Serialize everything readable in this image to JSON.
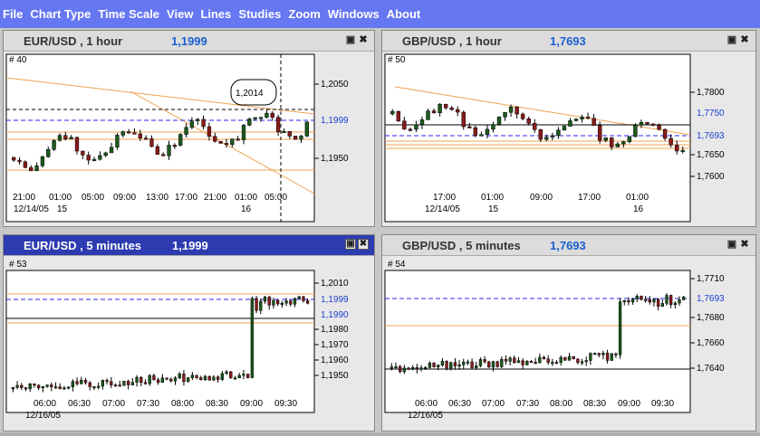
{
  "menu": [
    "File",
    "Chart Type",
    "Time Scale",
    "View",
    "Lines",
    "Studies",
    "Zoom",
    "Windows",
    "About"
  ],
  "colors": {
    "menubar": "#6677f2",
    "trendline": "#f0a050",
    "current": "#2a2af0",
    "up": "#1c5a1c",
    "down": "#8a1a1a"
  },
  "icons": {
    "minimize": "minimize-icon",
    "close": "close-icon"
  },
  "charts": [
    {
      "symbol": "EUR/USD , 1 hour",
      "price": "1,1999",
      "bar_id": "# 40",
      "active": false,
      "annotation": "1,2014",
      "y_ticks": [
        "1,2050",
        "1,1950"
      ],
      "current_label": "1,1999",
      "x_ticks": [
        "21:00",
        "01:00",
        "05:00",
        "09:00",
        "13:00",
        "17:00",
        "21:00",
        "01:00",
        "05:00"
      ],
      "date_labels": [
        "12/14/05",
        "15",
        "16"
      ]
    },
    {
      "symbol": "GBP/USD , 1 hour",
      "price": "1,7693",
      "bar_id": "# 50",
      "active": false,
      "y_ticks": [
        "1,7800",
        "1,7750",
        "1,7650",
        "1,7600"
      ],
      "current_label": "1,7693",
      "x_ticks": [
        "17:00",
        "01:00",
        "09:00",
        "17:00",
        "01:00"
      ],
      "date_labels": [
        "12/14/05",
        "15",
        "16"
      ]
    },
    {
      "symbol": "EUR/USD , 5 minutes",
      "price": "1,1999",
      "bar_id": "# 53",
      "active": true,
      "y_ticks": [
        "1,2010",
        "1,1980",
        "1,1970",
        "1,1960",
        "1,1950"
      ],
      "current_label": "1,1999",
      "extra_label": "1,1990",
      "x_ticks": [
        "06:00",
        "06:30",
        "07:00",
        "07:30",
        "08:00",
        "08:30",
        "09:00",
        "09:30"
      ],
      "date_labels": [
        "12/16/05"
      ]
    },
    {
      "symbol": "GBP/USD , 5 minutes",
      "price": "1,7693",
      "bar_id": "# 54",
      "active": false,
      "y_ticks": [
        "1,7710",
        "1,7680",
        "1,7660",
        "1,7640"
      ],
      "current_label": "1,7693",
      "x_ticks": [
        "06:00",
        "06:30",
        "07:00",
        "07:30",
        "08:00",
        "08:30",
        "09:00",
        "09:30"
      ],
      "date_labels": [
        "12/16/05"
      ]
    }
  ]
}
